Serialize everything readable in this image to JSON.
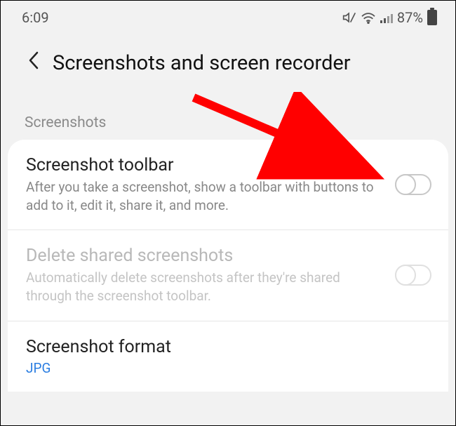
{
  "status": {
    "time": "6:09",
    "battery_pct": "87%"
  },
  "header": {
    "title": "Screenshots and screen recorder"
  },
  "section": {
    "label": "Screenshots"
  },
  "rows": {
    "toolbar": {
      "title": "Screenshot toolbar",
      "desc": "After you take a screenshot, show a toolbar with buttons to add to it, edit it, share it, and more."
    },
    "delete": {
      "title": "Delete shared screenshots",
      "desc": "Automatically delete screenshots after they're shared through the screenshot toolbar."
    },
    "format": {
      "title": "Screenshot format",
      "value": "JPG"
    }
  }
}
